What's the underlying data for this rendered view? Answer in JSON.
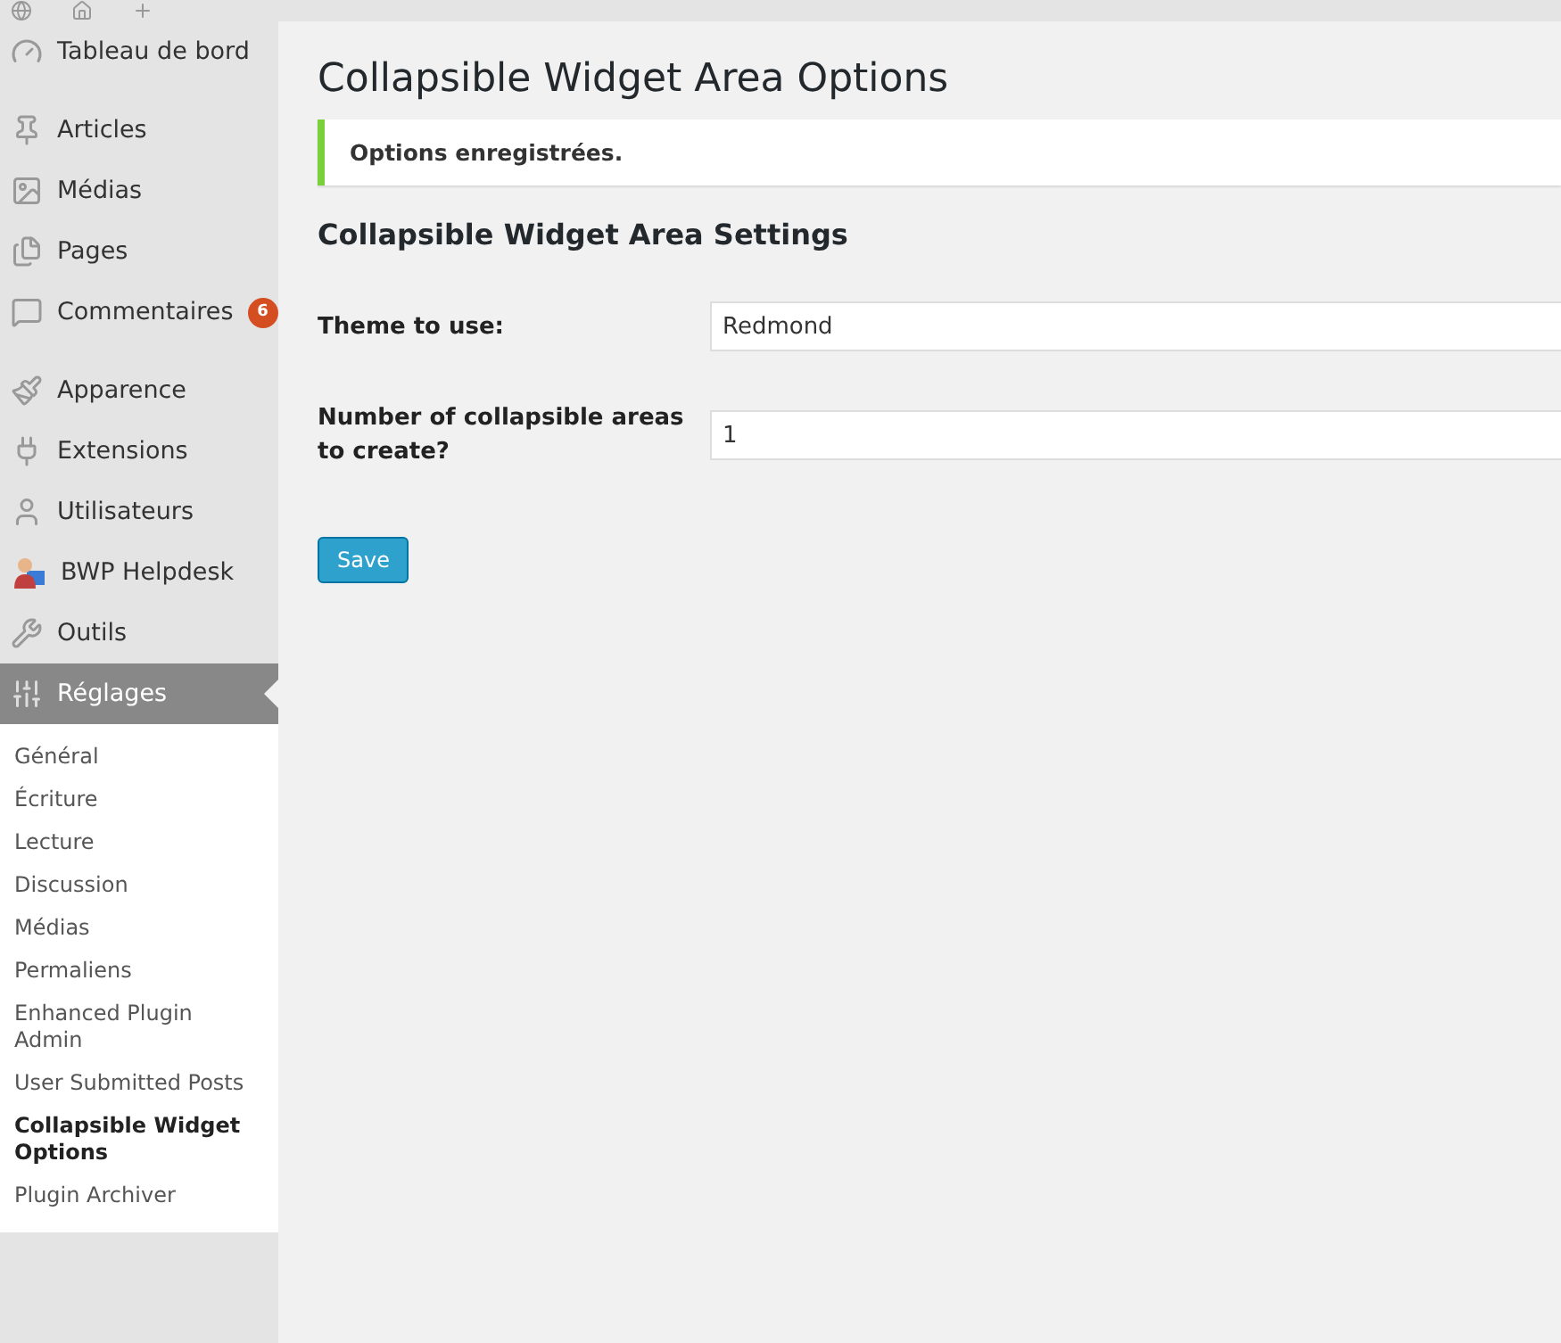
{
  "sidebar": {
    "menu_groups": [
      {
        "items": [
          {
            "label": "Tableau de bord",
            "selected": false
          }
        ]
      },
      {
        "items": [
          {
            "label": "Articles",
            "selected": false
          },
          {
            "label": "Médias",
            "selected": false
          },
          {
            "label": "Pages",
            "selected": false
          },
          {
            "label": "Commentaires",
            "selected": false,
            "badge": "6"
          }
        ]
      },
      {
        "items": [
          {
            "label": "Apparence",
            "selected": false
          },
          {
            "label": "Extensions",
            "selected": false
          },
          {
            "label": "Utilisateurs",
            "selected": false
          },
          {
            "label": "BWP Helpdesk",
            "selected": false
          },
          {
            "label": "Outils",
            "selected": false
          },
          {
            "label": "Réglages",
            "selected": true
          }
        ]
      }
    ],
    "submenu": [
      {
        "label": "Général",
        "selected": false
      },
      {
        "label": "Écriture",
        "selected": false
      },
      {
        "label": "Lecture",
        "selected": false
      },
      {
        "label": "Discussion",
        "selected": false
      },
      {
        "label": "Médias",
        "selected": false
      },
      {
        "label": "Permaliens",
        "selected": false
      },
      {
        "label": "Enhanced Plugin Admin",
        "selected": false
      },
      {
        "label": "User Submitted Posts",
        "selected": false
      },
      {
        "label": "Collapsible Widget Options",
        "selected": true
      },
      {
        "label": "Plugin Archiver",
        "selected": false
      }
    ]
  },
  "page": {
    "title": "Collapsible Widget Area Options",
    "notice": "Options enregistrées.",
    "section_title": "Collapsible Widget Area Settings",
    "fields": [
      {
        "label": "Theme to use:",
        "value": "Redmond"
      },
      {
        "label": "Number of collapsible areas to create?",
        "value": "1"
      }
    ],
    "save_button": "Save"
  }
}
